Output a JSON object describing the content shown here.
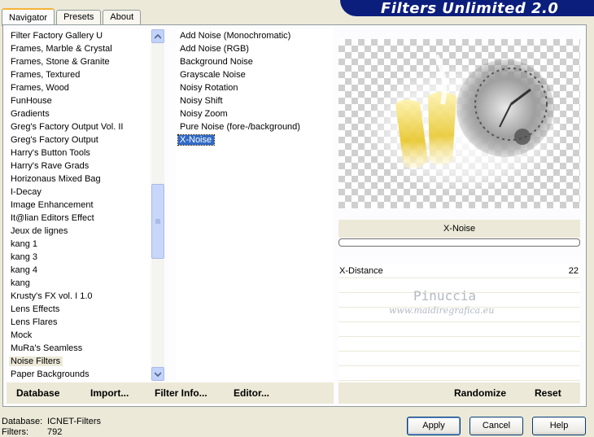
{
  "tabs": [
    {
      "label": "Navigator",
      "active": true
    },
    {
      "label": "Presets",
      "active": false
    },
    {
      "label": "About",
      "active": false
    }
  ],
  "banner": {
    "title": "Filters Unlimited 2.0",
    "color": "#0b1e7c"
  },
  "categories": [
    "Filter Factory Gallery U",
    "Frames, Marble & Crystal",
    "Frames, Stone & Granite",
    "Frames, Textured",
    "Frames, Wood",
    "FunHouse",
    "Gradients",
    "Greg's Factory Output Vol. II",
    "Greg's Factory Output",
    "Harry's Button Tools",
    "Harry's Rave Grads",
    "Horizonaus Mixed Bag",
    "I-Decay",
    "Image Enhancement",
    "It@lian Editors Effect",
    "Jeux de lignes",
    "kang 1",
    "kang 3",
    "kang 4",
    "kang",
    "Krusty's FX vol. I 1.0",
    "Lens Effects",
    "Lens Flares",
    "Mock",
    "MuRa's Seamless",
    "Noise Filters",
    "Paper Backgrounds"
  ],
  "selected_category": "Noise Filters",
  "filters": [
    "Add Noise (Monochromatic)",
    "Add Noise (RGB)",
    "Background Noise",
    "Grayscale Noise",
    "Noisy Rotation",
    "Noisy Shift",
    "Noisy Zoom",
    "Pure Noise (fore-/background)",
    "X-Noise"
  ],
  "selected_filter": "X-Noise",
  "preview": {
    "filter_title": "X-Noise"
  },
  "params": [
    {
      "label": "X-Distance",
      "value": "22"
    }
  ],
  "watermark": {
    "name": "Pinuccia",
    "url": "www.maidiregrafica.eu"
  },
  "toolbar_left": {
    "database": "Database",
    "import": "Import...",
    "filter_info": "Filter Info...",
    "editor": "Editor..."
  },
  "toolbar_right": {
    "randomize": "Randomize",
    "reset": "Reset"
  },
  "status": {
    "database_label": "Database:",
    "database_value": "ICNET-Filters",
    "filters_label": "Filters:",
    "filters_value": "792"
  },
  "buttons": {
    "apply": "Apply",
    "cancel": "Cancel",
    "help": "Help"
  }
}
